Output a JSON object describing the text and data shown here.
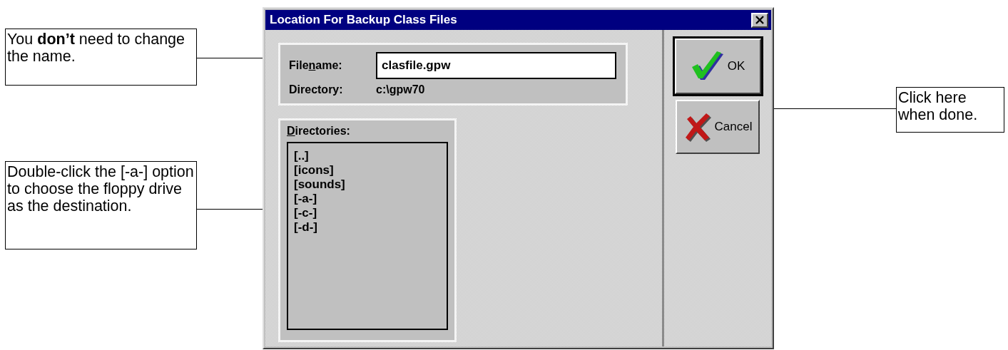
{
  "callouts": [
    {
      "text": "You **don’t** need to change the name."
    },
    {
      "text": "Double-click the [-a-] option to choose the floppy drive as the destination."
    },
    {
      "text": "Click here when done."
    }
  ],
  "dialog": {
    "title": "Location For Backup Class Files",
    "filename": {
      "label": {
        "before": "File",
        "key": "n",
        "after": "ame:"
      },
      "value": "clasfile.gpw"
    },
    "directory": {
      "label": "Directory:",
      "value": "c:\\gpw70"
    },
    "directories": {
      "label": {
        "key": "D",
        "after": "irectories:"
      },
      "items": [
        "[..]",
        "[icons]",
        "[sounds]",
        "[-a-]",
        "[-c-]",
        "[-d-]"
      ]
    },
    "buttons": [
      {
        "kind": "ok",
        "label": "OK",
        "default": true
      },
      {
        "kind": "cancel",
        "label": "Cancel",
        "default": false
      }
    ]
  }
}
